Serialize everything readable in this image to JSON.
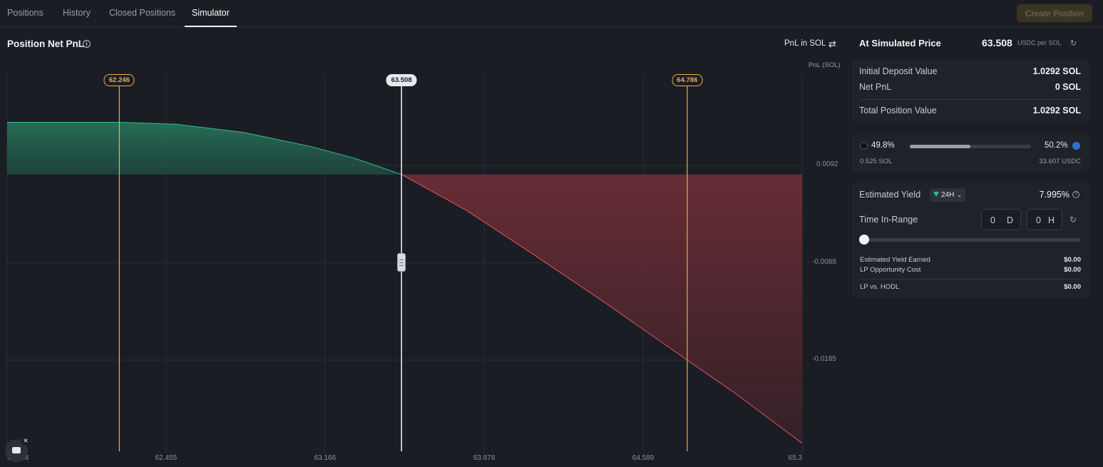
{
  "tabs": [
    {
      "label": "Positions",
      "active": false
    },
    {
      "label": "History",
      "active": false
    },
    {
      "label": "Closed Positions",
      "active": false
    },
    {
      "label": "Simulator",
      "active": true
    }
  ],
  "header": {
    "create_position_label": "Create Position"
  },
  "chart_panel": {
    "title": "Position Net PnL",
    "pnl_toggle_label": "PnL in SOL",
    "axis_unit_label": "PnL (SOL)"
  },
  "chart_data": {
    "type": "area",
    "ylabel": "PnL (SOL)",
    "x_ticks": [
      "62.744",
      "62.455",
      "63.166",
      "63.878",
      "64.589",
      "65.3"
    ],
    "x_tick_values": [
      61.744,
      62.455,
      63.166,
      63.878,
      64.589,
      65.3
    ],
    "y_ticks": [
      "0.0092",
      "-0.0088",
      "-0.0185"
    ],
    "y_tick_values": [
      0.0009,
      -0.0088,
      -0.0185
    ],
    "xlim": [
      61.744,
      65.3
    ],
    "ylim": [
      -0.0276,
      0.01
    ],
    "series": [
      {
        "values_x": [
          61.744,
          62.0,
          62.246,
          62.5,
          62.8,
          63.1,
          63.3,
          63.508,
          63.8,
          64.1,
          64.4,
          64.786,
          65.0,
          65.3
        ],
        "values_y": [
          0.0052,
          0.0052,
          0.0052,
          0.005,
          0.0042,
          0.0028,
          0.0016,
          0.0,
          -0.0036,
          -0.008,
          -0.0125,
          -0.0185,
          -0.0218,
          -0.0268
        ]
      }
    ],
    "markers": {
      "lower": {
        "label": "62.246",
        "x": 62.246
      },
      "current": {
        "label": "63.508",
        "x": 63.508
      },
      "upper": {
        "label": "64.786",
        "x": 64.786
      }
    },
    "colors": {
      "profit": "#2fbf8f",
      "loss": "#e05561",
      "range": "#e3b341",
      "current": "#e8e9ec"
    }
  },
  "simulated": {
    "title": "At Simulated Price",
    "price": "63.508",
    "unit": "USDC per SOL"
  },
  "summary": {
    "initial_deposit_label": "Initial Deposit Value",
    "initial_deposit_value": "1.0292 SOL",
    "net_pnl_label": "Net PnL",
    "net_pnl_value": "0 SOL",
    "total_label": "Total Position Value",
    "total_value": "1.0292 SOL"
  },
  "composition": {
    "sol_pct": "49.8%",
    "usdc_pct": "50.2%",
    "sol_fraction": 0.498,
    "sol_amount": "0.525 SOL",
    "usdc_amount": "33.607 USDC"
  },
  "yield": {
    "label": "Estimated Yield",
    "period": "24H",
    "value": "7.995%",
    "time_in_range_label": "Time In-Range",
    "days": "0",
    "days_unit": "D",
    "hours": "0",
    "hours_unit": "H",
    "slider_fraction": 0,
    "earned_label": "Estimated Yield Earned",
    "earned_value": "$0.00",
    "opportunity_label": "LP Opportunity Cost",
    "opportunity_value": "$0.00",
    "hodl_label": "LP vs. HODL",
    "hodl_value": "$0.00"
  }
}
